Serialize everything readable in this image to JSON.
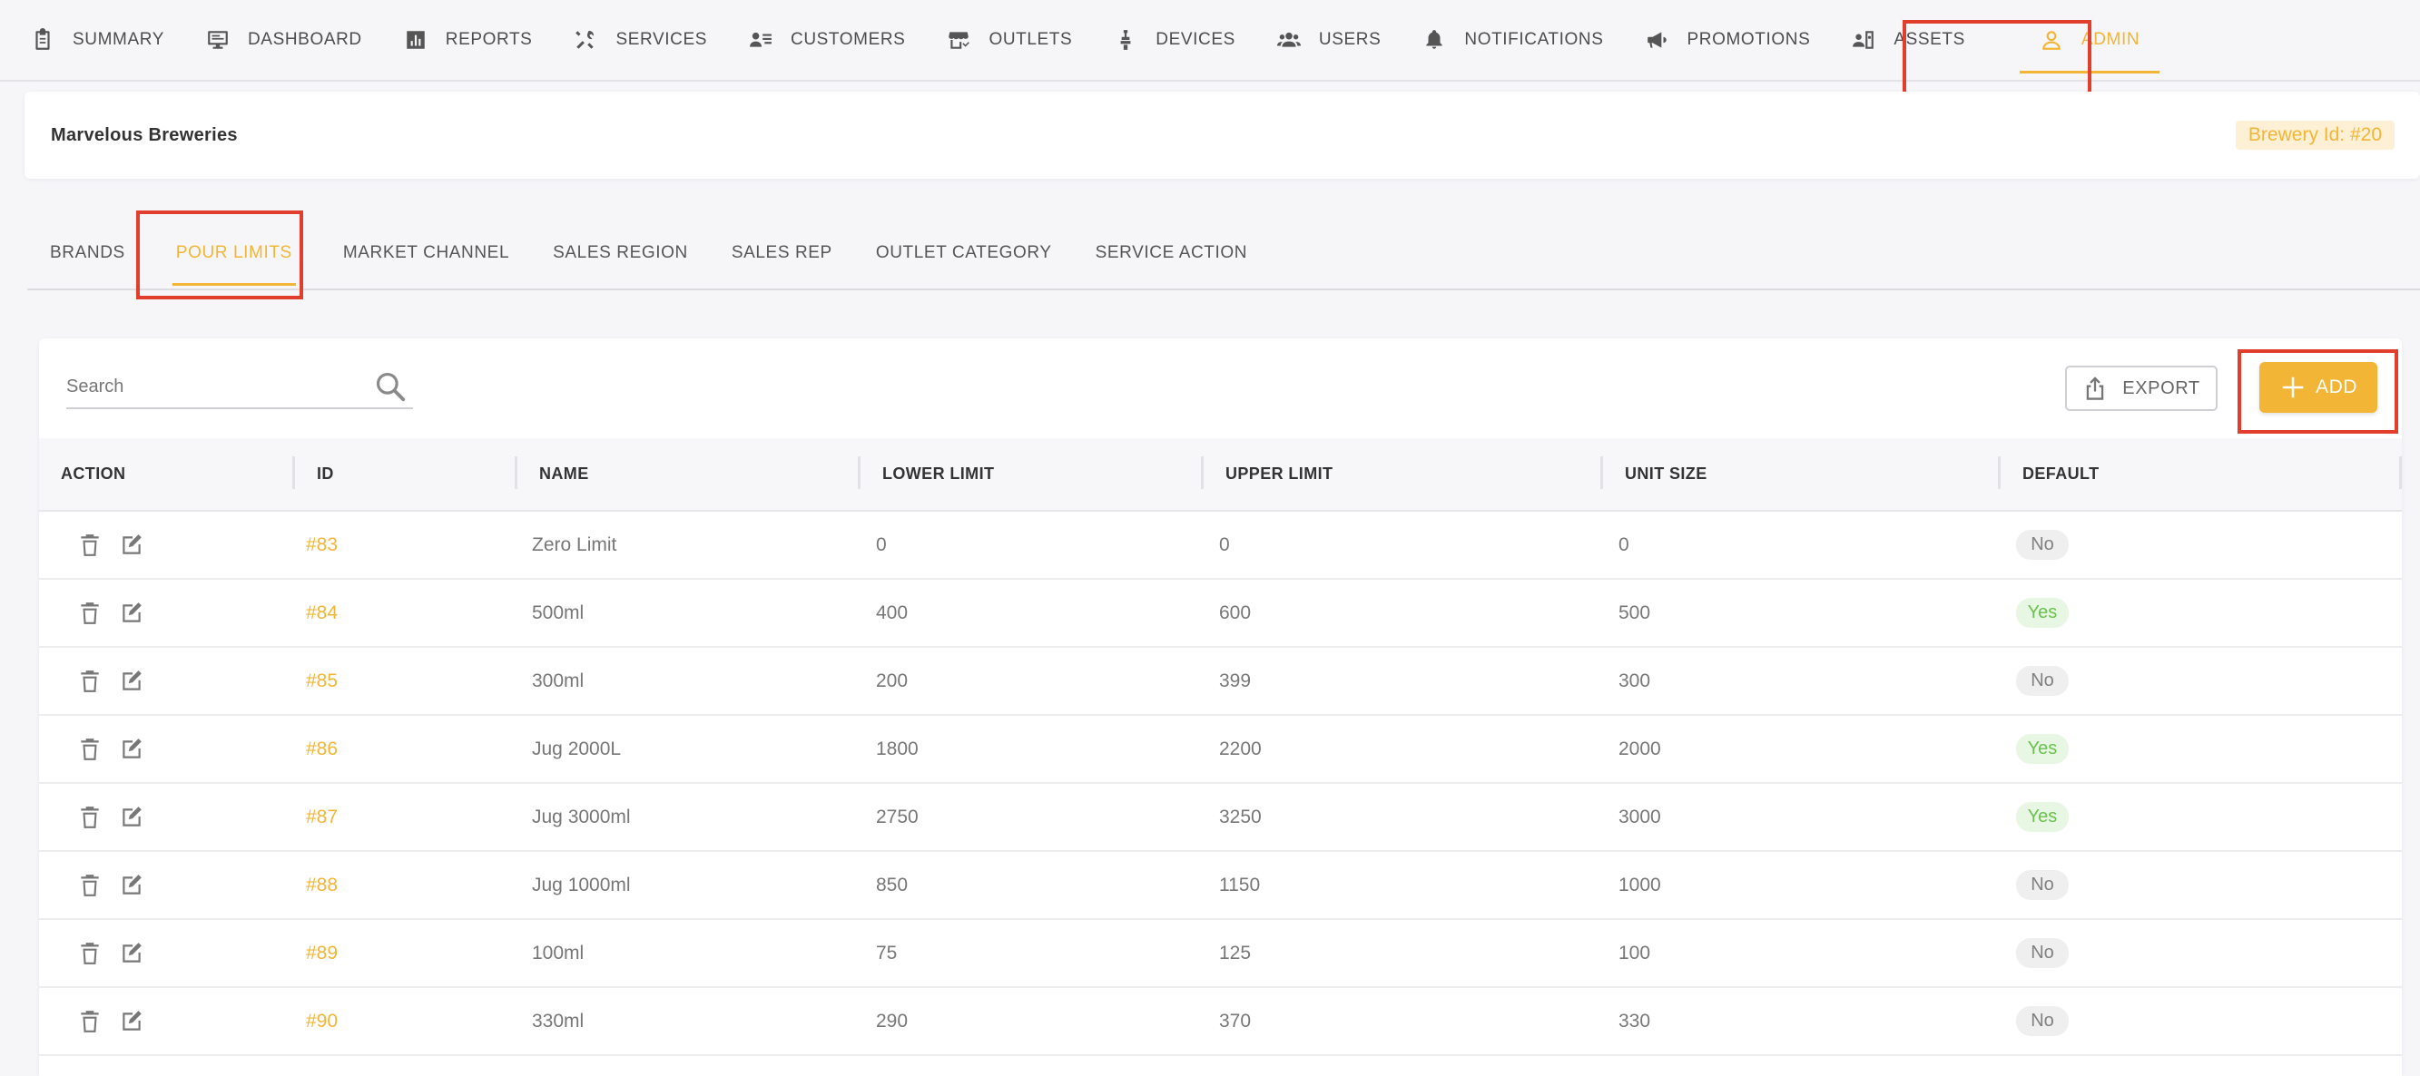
{
  "nav": {
    "items": [
      {
        "label": "SUMMARY",
        "icon": "clipboard-icon"
      },
      {
        "label": "DASHBOARD",
        "icon": "monitor-icon"
      },
      {
        "label": "REPORTS",
        "icon": "bar-chart-icon"
      },
      {
        "label": "SERVICES",
        "icon": "tools-icon"
      },
      {
        "label": "CUSTOMERS",
        "icon": "contact-list-icon"
      },
      {
        "label": "OUTLETS",
        "icon": "store-icon"
      },
      {
        "label": "DEVICES",
        "icon": "tap-icon"
      },
      {
        "label": "USERS",
        "icon": "group-icon"
      },
      {
        "label": "NOTIFICATIONS",
        "icon": "bell-icon"
      },
      {
        "label": "PROMOTIONS",
        "icon": "megaphone-icon"
      },
      {
        "label": "ASSETS",
        "icon": "assets-icon"
      },
      {
        "label": "ADMIN",
        "icon": "person-icon",
        "active": true
      }
    ]
  },
  "brewery": {
    "name": "Marvelous Breweries",
    "badge": "Brewery Id: #20"
  },
  "subtabs": [
    {
      "label": "BRANDS"
    },
    {
      "label": "POUR LIMITS",
      "active": true
    },
    {
      "label": "MARKET CHANNEL"
    },
    {
      "label": "SALES REGION"
    },
    {
      "label": "SALES REP"
    },
    {
      "label": "OUTLET CATEGORY"
    },
    {
      "label": "SERVICE ACTION"
    }
  ],
  "toolbar": {
    "search_placeholder": "Search",
    "export_label": "EXPORT",
    "add_label": "ADD"
  },
  "table": {
    "columns": [
      "ACTION",
      "ID",
      "NAME",
      "LOWER LIMIT",
      "UPPER LIMIT",
      "UNIT SIZE",
      "DEFAULT"
    ],
    "rows": [
      {
        "id": "#83",
        "name": "Zero Limit",
        "lower": "0",
        "upper": "0",
        "unit": "0",
        "default": "No"
      },
      {
        "id": "#84",
        "name": "500ml",
        "lower": "400",
        "upper": "600",
        "unit": "500",
        "default": "Yes"
      },
      {
        "id": "#85",
        "name": "300ml",
        "lower": "200",
        "upper": "399",
        "unit": "300",
        "default": "No"
      },
      {
        "id": "#86",
        "name": "Jug 2000L",
        "lower": "1800",
        "upper": "2200",
        "unit": "2000",
        "default": "Yes"
      },
      {
        "id": "#87",
        "name": "Jug 3000ml",
        "lower": "2750",
        "upper": "3250",
        "unit": "3000",
        "default": "Yes"
      },
      {
        "id": "#88",
        "name": "Jug 1000ml",
        "lower": "850",
        "upper": "1150",
        "unit": "1000",
        "default": "No"
      },
      {
        "id": "#89",
        "name": "100ml",
        "lower": "75",
        "upper": "125",
        "unit": "100",
        "default": "No"
      },
      {
        "id": "#90",
        "name": "330ml",
        "lower": "290",
        "upper": "370",
        "unit": "330",
        "default": "No"
      }
    ]
  },
  "colors": {
    "accent": "#f3b535",
    "highlight": "#e23e2d",
    "yes_text": "#6ac24f",
    "no_text": "#808080"
  }
}
